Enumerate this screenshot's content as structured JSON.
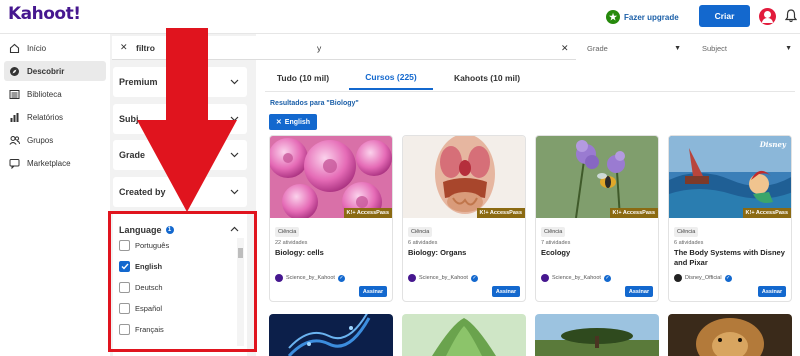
{
  "app": {
    "logo": "Kahoot!"
  },
  "header": {
    "upgrade_label": "Fazer upgrade",
    "create_label": "Criar"
  },
  "nav": {
    "items": [
      {
        "label": "Início",
        "icon": "home-icon",
        "active": false
      },
      {
        "label": "Descobrir",
        "icon": "compass-icon",
        "active": true
      },
      {
        "label": "Biblioteca",
        "icon": "list-icon",
        "active": false
      },
      {
        "label": "Relatórios",
        "icon": "chart-icon",
        "active": false
      },
      {
        "label": "Grupos",
        "icon": "users-icon",
        "active": false
      },
      {
        "label": "Marketplace",
        "icon": "chat-icon",
        "active": false
      }
    ]
  },
  "search": {
    "chip_label": "filtro",
    "query_visible": "y"
  },
  "selects": {
    "grade": "Grade",
    "subject": "Subject"
  },
  "filters": {
    "premium": "Premium",
    "subject": "Subj",
    "grade": "Grade",
    "created_by": "Created by",
    "language": {
      "title": "Language",
      "count": "1",
      "options": [
        {
          "label": "Português",
          "checked": false
        },
        {
          "label": "English",
          "checked": true
        },
        {
          "label": "Deutsch",
          "checked": false
        },
        {
          "label": "Español",
          "checked": false
        },
        {
          "label": "Français",
          "checked": false
        }
      ]
    }
  },
  "tabs": [
    {
      "label": "Tudo (10 mil)",
      "active": false
    },
    {
      "label": "Cursos (225)",
      "active": true
    },
    {
      "label": "Kahoots (10 mil)",
      "active": false
    }
  ],
  "results": {
    "label": "Resultados para \"Biology\"",
    "active_chip": "English"
  },
  "cards": [
    {
      "category": "Ciência",
      "count": "22 atividades",
      "title": "Biology: cells",
      "author": "Science_by_Kahoot",
      "badge": "K!+ AccessPass",
      "cta": "Assinar"
    },
    {
      "category": "Ciência",
      "count": "6 atividades",
      "title": "Biology: Organs",
      "author": "Science_by_Kahoot",
      "badge": "K!+ AccessPass",
      "cta": "Assinar"
    },
    {
      "category": "Ciência",
      "count": "7 atividades",
      "title": "Ecology",
      "author": "Science_by_Kahoot",
      "badge": "K!+ AccessPass",
      "cta": "Assinar"
    },
    {
      "category": "Ciência",
      "count": "6 atividades",
      "title": "The Body Systems with Disney and Pixar",
      "author": "Disney_Official",
      "badge": "K!+ AccessPass",
      "cta": "Assinar",
      "brand": "Disney"
    }
  ],
  "colors": {
    "brand_purple": "#46178f",
    "primary_blue": "#1368ce",
    "annotation_red": "#e0141e",
    "upgrade_green": "#26890c"
  }
}
